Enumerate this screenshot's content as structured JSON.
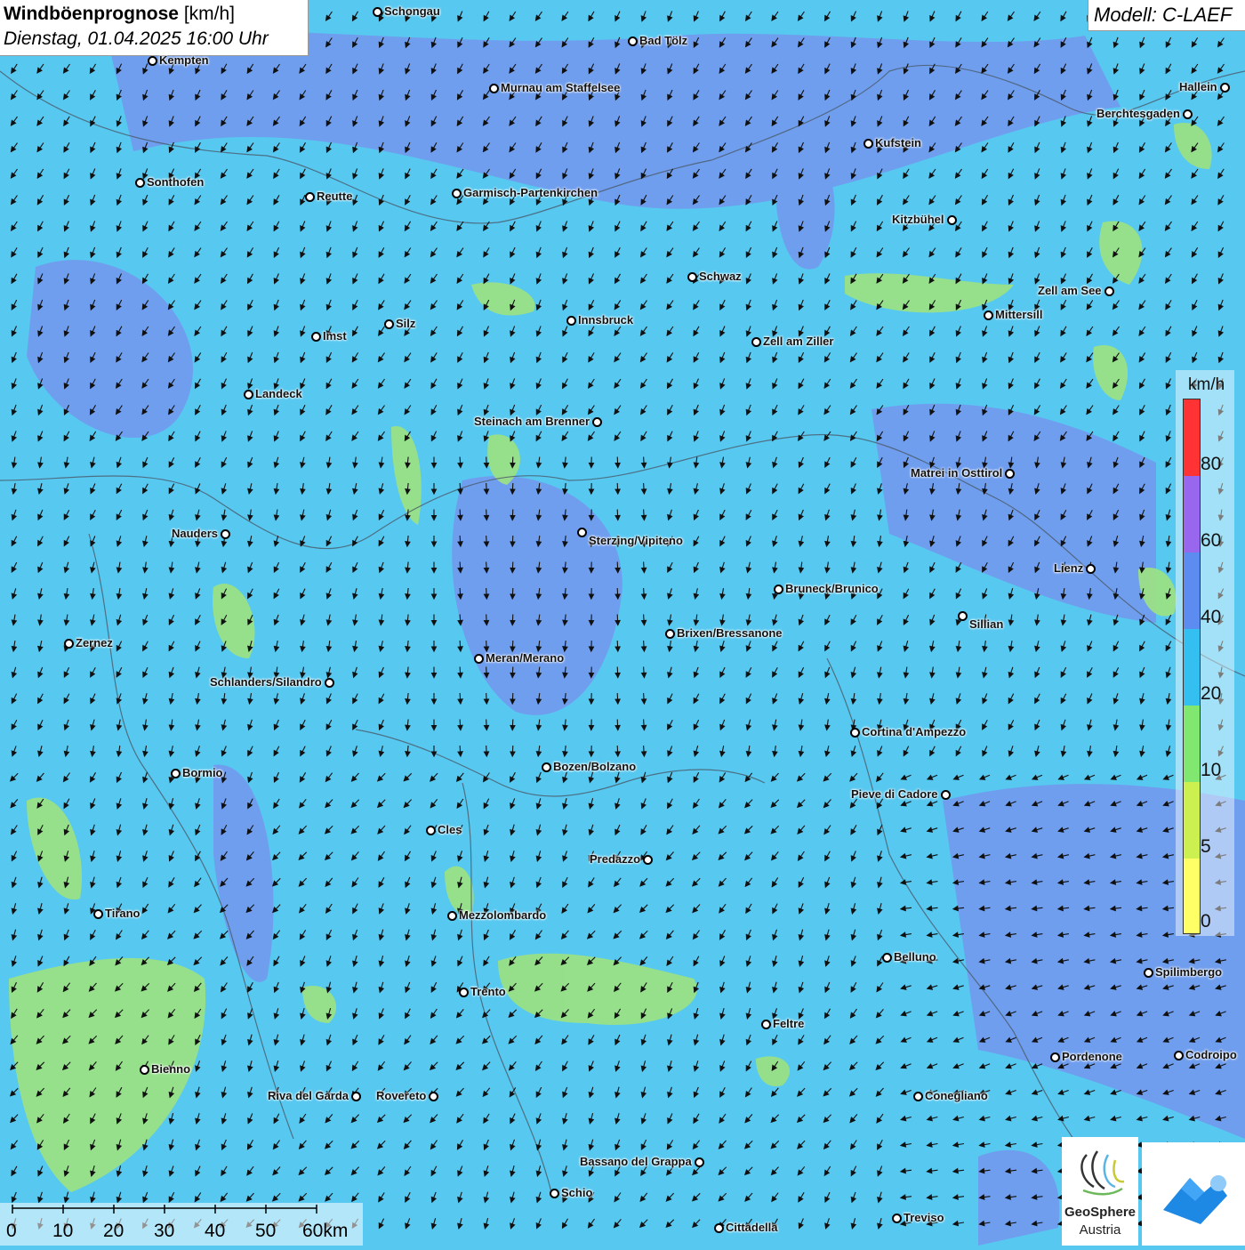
{
  "title": {
    "main": "Windböenprognose",
    "unit": "[km/h]",
    "datetime": "Dienstag, 01.04.2025 16:00 Uhr"
  },
  "model": "Modell: C-LAEF",
  "legend": {
    "unit": "km/h",
    "values": [
      "80",
      "60",
      "40",
      "20",
      "10",
      "5",
      "0"
    ],
    "colors": [
      "#ff3333",
      "#9966ee",
      "#5c8cf0",
      "#33c0f0",
      "#80e870",
      "#ccf050",
      "#ffff66"
    ]
  },
  "scale": {
    "labels": [
      "0",
      "10",
      "20",
      "30",
      "40",
      "50",
      "60km"
    ]
  },
  "logo": {
    "name": "GeoSphere",
    "sub": "Austria"
  },
  "colors": {
    "background_field": "#57c8f0",
    "stronger_gust_field": "#6f8ff0",
    "weak_gust_field": "#9de27f"
  },
  "cities": [
    {
      "name": "Schongau"
    },
    {
      "name": "Bad Tölz"
    },
    {
      "name": "Kempten"
    },
    {
      "name": "Murnau am Staffelsee"
    },
    {
      "name": "Hallein"
    },
    {
      "name": "Berchtesgaden"
    },
    {
      "name": "Kufstein"
    },
    {
      "name": "Sonthofen"
    },
    {
      "name": "Reutte"
    },
    {
      "name": "Garmisch-Partenkirchen"
    },
    {
      "name": "Kitzbühel"
    },
    {
      "name": "Schwaz"
    },
    {
      "name": "Zell am See"
    },
    {
      "name": "Mittersill"
    },
    {
      "name": "Innsbruck"
    },
    {
      "name": "Silz"
    },
    {
      "name": "Imst"
    },
    {
      "name": "Zell am Ziller"
    },
    {
      "name": "Landeck"
    },
    {
      "name": "Steinach am Brenner"
    },
    {
      "name": "Matrei in Osttirol"
    },
    {
      "name": "Nauders"
    },
    {
      "name": "Sterzing/Vipiteno"
    },
    {
      "name": "Lienz"
    },
    {
      "name": "Bruneck/Brunico"
    },
    {
      "name": "Sillian"
    },
    {
      "name": "Brixen/Bressanone"
    },
    {
      "name": "Zernez"
    },
    {
      "name": "Meran/Merano"
    },
    {
      "name": "Schlanders/Silandro"
    },
    {
      "name": "Cortina d'Ampezzo"
    },
    {
      "name": "Bozen/Bolzano"
    },
    {
      "name": "Bormio"
    },
    {
      "name": "Pieve di Cadore"
    },
    {
      "name": "Cles"
    },
    {
      "name": "Predazzo"
    },
    {
      "name": "Tirano"
    },
    {
      "name": "Mezzolombardo"
    },
    {
      "name": "Belluno"
    },
    {
      "name": "Spilimbergo"
    },
    {
      "name": "Trento"
    },
    {
      "name": "Feltre"
    },
    {
      "name": "Pordenone"
    },
    {
      "name": "Codroipo"
    },
    {
      "name": "Bienno"
    },
    {
      "name": "Riva del Garda"
    },
    {
      "name": "Rovereto"
    },
    {
      "name": "Conegliano"
    },
    {
      "name": "Bassano del Grappa"
    },
    {
      "name": "Schio"
    },
    {
      "name": "Treviso"
    },
    {
      "name": "Cittadella"
    }
  ]
}
